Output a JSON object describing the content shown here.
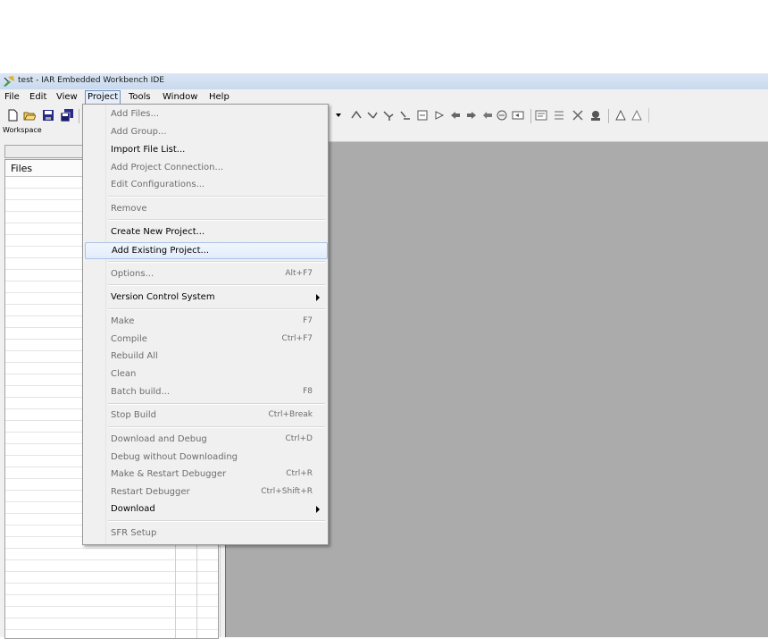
{
  "window": {
    "title": "test - IAR Embedded Workbench IDE"
  },
  "menubar": {
    "items": [
      "File",
      "Edit",
      "View",
      "Project",
      "Tools",
      "Window",
      "Help"
    ],
    "active": "Project"
  },
  "toolbar": {
    "icons": [
      "new-file-icon",
      "open-icon",
      "save-icon",
      "save-all-icon"
    ],
    "debug_icons": [
      "toggle-breakpoint-icon",
      "step-over-icon",
      "step-into-icon",
      "step-out-icon",
      "run-to-cursor-icon",
      "next-statement-icon",
      "back-icon",
      "forward-icon",
      "bookmark-icon",
      "goto-icon",
      "compile-icon",
      "make-icon",
      "stop-build-icon",
      "debug-icon",
      "download-debug-icon",
      "debug-no-download-icon"
    ]
  },
  "workspace": {
    "title": "Workspace",
    "files_header": "Files"
  },
  "project_menu": {
    "items": [
      {
        "label": "Add Files...",
        "shortcut": "",
        "enabled": false
      },
      {
        "label": "Add Group...",
        "shortcut": "",
        "enabled": false
      },
      {
        "label": "Import File List...",
        "shortcut": "",
        "enabled": true
      },
      {
        "label": "Add Project Connection...",
        "shortcut": "",
        "enabled": false
      },
      {
        "label": "Edit Configurations...",
        "shortcut": "",
        "enabled": false
      },
      {
        "label": "Remove",
        "shortcut": "",
        "enabled": false
      },
      {
        "label": "Create New Project...",
        "shortcut": "",
        "enabled": true
      },
      {
        "label": "Add Existing Project...",
        "shortcut": "",
        "enabled": true,
        "highlighted": true
      },
      {
        "label": "Options...",
        "shortcut": "Alt+F7",
        "enabled": false
      },
      {
        "label": "Version Control System",
        "shortcut": "",
        "enabled": true,
        "submenu": true
      },
      {
        "label": "Make",
        "shortcut": "F7",
        "enabled": false
      },
      {
        "label": "Compile",
        "shortcut": "Ctrl+F7",
        "enabled": false
      },
      {
        "label": "Rebuild All",
        "shortcut": "",
        "enabled": false
      },
      {
        "label": "Clean",
        "shortcut": "",
        "enabled": false
      },
      {
        "label": "Batch build...",
        "shortcut": "F8",
        "enabled": false
      },
      {
        "label": "Stop Build",
        "shortcut": "Ctrl+Break",
        "enabled": false
      },
      {
        "label": "Download and Debug",
        "shortcut": "Ctrl+D",
        "enabled": false
      },
      {
        "label": "Debug without Downloading",
        "shortcut": "",
        "enabled": false
      },
      {
        "label": "Make & Restart Debugger",
        "shortcut": "Ctrl+R",
        "enabled": false
      },
      {
        "label": "Restart Debugger",
        "shortcut": "Ctrl+Shift+R",
        "enabled": false
      },
      {
        "label": "Download",
        "shortcut": "",
        "enabled": true,
        "submenu": true
      },
      {
        "label": "SFR Setup",
        "shortcut": "",
        "enabled": false
      }
    ]
  }
}
